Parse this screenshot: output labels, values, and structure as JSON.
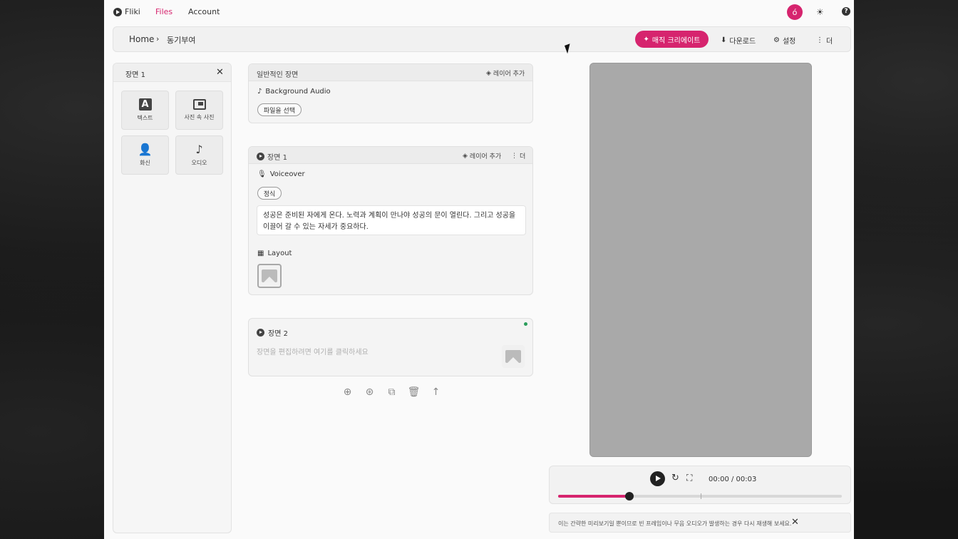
{
  "topnav": {
    "brand": "Fliki",
    "files": "Files",
    "account": "Account",
    "avatar_initial": "ó"
  },
  "toolbar": {
    "home": "Home",
    "separator": "›",
    "current": "동기부여",
    "magic_create": "매직 크리에이트",
    "download": "다운로드",
    "settings": "설정",
    "more": "더"
  },
  "left_panel": {
    "title": "장면 1",
    "tiles": [
      {
        "label": "텍스트",
        "icon": "text-icon"
      },
      {
        "label": "사진 속 사진",
        "icon": "picture-in-picture-icon"
      },
      {
        "label": "화신",
        "icon": "avatar-person-icon"
      },
      {
        "label": "오디오",
        "icon": "music-note-icon"
      }
    ]
  },
  "general_scene": {
    "title": "일반적인 장면",
    "add_layer": "레이어 추가",
    "audio_label": "Background Audio",
    "choose_file": "파일을 선택"
  },
  "scene1": {
    "title": "장면 1",
    "add_layer": "레이어 추가",
    "more": "더",
    "voiceover_label": "Voiceover",
    "voice_style": "정식",
    "text": "성공은 준비된 자에게 온다. 노력과 계획이 만나야 성공의 문이 열린다. 그리고 성공을 이끌어 갈 수 있는 자세가 중요하다.",
    "layout_label": "Layout"
  },
  "scene2": {
    "title": "장면 2",
    "placeholder": "장면을 편집하려면 여기를 클릭하세요"
  },
  "player": {
    "time": "00:00 / 00:03",
    "progress_fraction": 0.25
  },
  "notice": {
    "text": "이는 간략한 미리보기일 뿐이므로 빈 프레임이나 무음 오디오가 발생하는 경우 다시 재생해 보세요."
  },
  "colors": {
    "accent": "#d6246e",
    "status_green": "#2a9d5a"
  }
}
